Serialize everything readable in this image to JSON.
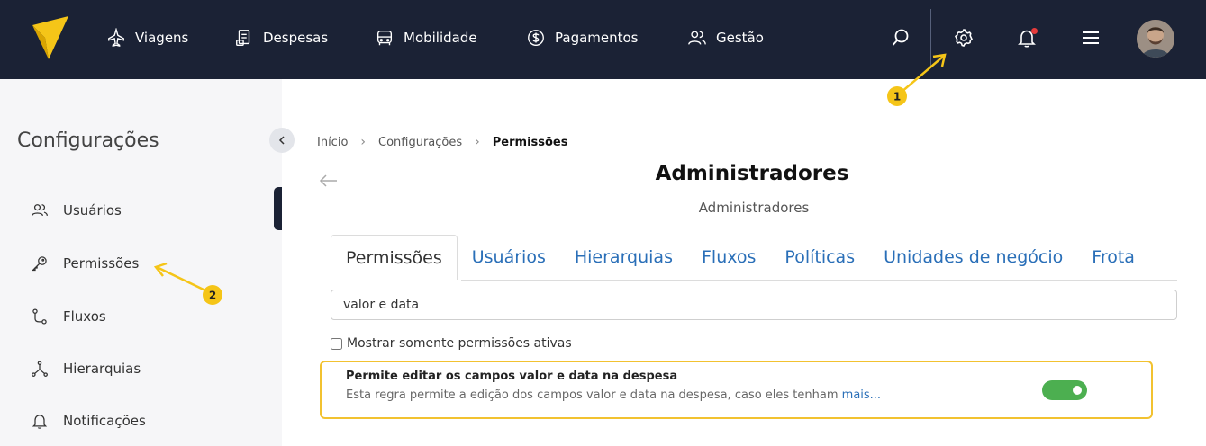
{
  "topbar": {
    "nav": [
      {
        "label": "Viagens",
        "icon": "plane-icon"
      },
      {
        "label": "Despesas",
        "icon": "receipt-icon"
      },
      {
        "label": "Mobilidade",
        "icon": "car-icon"
      },
      {
        "label": "Pagamentos",
        "icon": "dollar-icon"
      },
      {
        "label": "Gestão",
        "icon": "users-icon"
      }
    ],
    "icons": [
      "search-icon",
      "gear-icon",
      "bell-icon",
      "menu-icon"
    ],
    "colors": {
      "bar": "#1b2235",
      "notification_dot": "#e53b3b",
      "logo": "#f5c518"
    }
  },
  "sidebar": {
    "title": "Configurações",
    "items": [
      {
        "label": "Usuários",
        "icon": "users-icon"
      },
      {
        "label": "Permissões",
        "icon": "key-icon"
      },
      {
        "label": "Fluxos",
        "icon": "flow-icon"
      },
      {
        "label": "Hierarquias",
        "icon": "hierarchy-icon"
      },
      {
        "label": "Notificações",
        "icon": "bell-icon"
      }
    ],
    "active_index": 1
  },
  "breadcrumb": {
    "items": [
      "Início",
      "Configurações",
      "Permissões"
    ]
  },
  "page": {
    "title": "Administradores",
    "subtitle": "Administradores"
  },
  "tabs": [
    {
      "label": "Permissões",
      "active": true
    },
    {
      "label": "Usuários",
      "active": false
    },
    {
      "label": "Hierarquias",
      "active": false
    },
    {
      "label": "Fluxos",
      "active": false
    },
    {
      "label": "Políticas",
      "active": false
    },
    {
      "label": "Unidades de negócio",
      "active": false
    },
    {
      "label": "Frota",
      "active": false
    }
  ],
  "filter": {
    "value": "valor e data"
  },
  "active_only": {
    "label": "Mostrar somente permissões ativas",
    "checked": false
  },
  "permission": {
    "title": "Permite editar os campos valor e data na despesa",
    "description": "Esta regra permite a edição dos campos valor e data na despesa, caso eles tenham",
    "more_label": "mais...",
    "enabled": true,
    "highlight_color": "#f2c230",
    "toggle_color": "#4caf50"
  },
  "annotations": {
    "step1": "1",
    "step2": "2",
    "color": "#f5c518"
  }
}
